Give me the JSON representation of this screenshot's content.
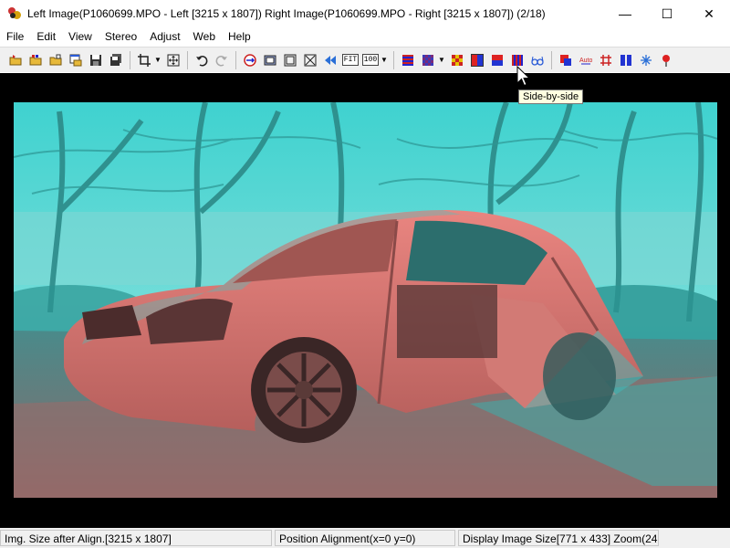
{
  "window": {
    "title": "Left Image(P1060699.MPO - Left [3215 x 1807]) Right Image(P1060699.MPO - Right [3215 x 1807])  (2/18)",
    "controls": {
      "minimize": "—",
      "maximize": "☐",
      "close": "✕"
    }
  },
  "menu": {
    "items": [
      "File",
      "Edit",
      "View",
      "Stereo",
      "Adjust",
      "Web",
      "Help"
    ]
  },
  "toolbar": {
    "fit_label": "FIT",
    "hundred_label": "100",
    "icons": [
      "open-folder-icon",
      "open-left-right-icon",
      "open-folder-icon-2",
      "open-window-icon",
      "save-icon",
      "save-multiple-icon",
      "crop-icon",
      "center-align-icon",
      "undo-icon",
      "redo-icon",
      "swap-icon",
      "fit-frame-icon",
      "frame-icon",
      "fullscreen-icon",
      "prev-next-icon",
      "fit-icon",
      "zoom-100-icon",
      "interlaced-icon",
      "checkered-icon",
      "color-anaglyph-icon",
      "side-by-side-icon",
      "over-under-icon",
      "vertical-stripes-icon",
      "glasses-icon",
      "red-cyan-icon",
      "auto-icon",
      "grid-icon",
      "split-icon",
      "snowflake-icon",
      "pin-icon"
    ],
    "tooltip": "Side-by-side"
  },
  "status": {
    "size_after_align": "Img. Size after Align.[3215 x 1807]",
    "position_alignment": "Position Alignment(x=0 y=0)",
    "display_size": "Display Image Size[771 x 433]  Zoom(24 %)"
  },
  "colors": {
    "anaglyph_red": "#e2706b",
    "anaglyph_cyan": "#3cc6c4",
    "viewport_bg": "#000000"
  }
}
